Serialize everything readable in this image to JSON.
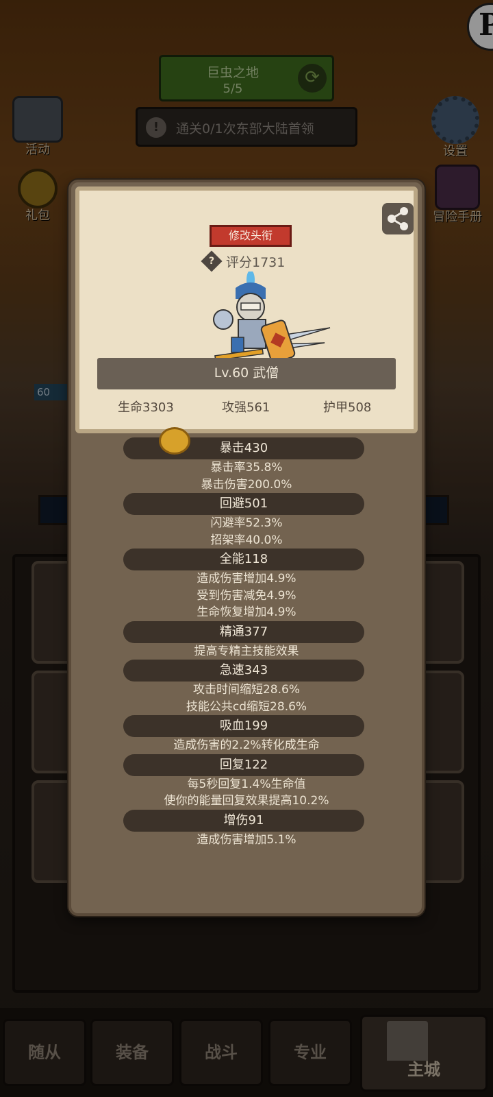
{
  "background": {
    "stage": {
      "name": "巨虫之地",
      "progress": "5/5"
    },
    "quest": {
      "text": "通关0/1次东部大陆首领"
    },
    "left_buttons": [
      {
        "label": "活动",
        "icon": "activity-icon"
      },
      {
        "label": "礼包",
        "icon": "gift-icon"
      }
    ],
    "right_buttons": [
      {
        "label": "设置",
        "icon": "gear-icon"
      },
      {
        "label": "冒险手册",
        "icon": "handbook-icon"
      }
    ],
    "hero_level_badge": "60"
  },
  "tabs": [
    {
      "label": "随从"
    },
    {
      "label": "装备"
    },
    {
      "label": "战斗"
    },
    {
      "label": "专业"
    },
    {
      "label": "主城",
      "active": true
    }
  ],
  "modal": {
    "title_button": "修改头衔",
    "score": "评分1731",
    "hero_name": "Lv.60 武僧",
    "base_stats": {
      "hp": "生命3303",
      "attack": "攻强561",
      "armor": "护甲508"
    },
    "stats": [
      {
        "header": "暴击430",
        "lines": [
          "暴击率35.8%",
          "暴击伤害200.0%"
        ]
      },
      {
        "header": "回避501",
        "lines": [
          "闪避率52.3%",
          "招架率40.0%"
        ]
      },
      {
        "header": "全能118",
        "lines": [
          "造成伤害增加4.9%",
          "受到伤害减免4.9%",
          "生命恢复增加4.9%"
        ]
      },
      {
        "header": "精通377",
        "lines": [
          "提高专精主技能效果"
        ]
      },
      {
        "header": "急速343",
        "lines": [
          "攻击时间缩短28.6%",
          "技能公共cd缩短28.6%"
        ]
      },
      {
        "header": "吸血199",
        "lines": [
          "造成伤害的2.2%转化成生命"
        ]
      },
      {
        "header": "回复122",
        "lines": [
          "每5秒回复1.4%生命值",
          "使你的能量回复效果提高10.2%"
        ]
      },
      {
        "header": "增伤91",
        "lines": [
          "造成伤害增加5.1%"
        ]
      }
    ]
  },
  "colors": {
    "title_button": "#c23a2d",
    "modal_bg": "#736350",
    "card_bg": "#ece0c6",
    "stage_green": "#3e6b1e"
  }
}
